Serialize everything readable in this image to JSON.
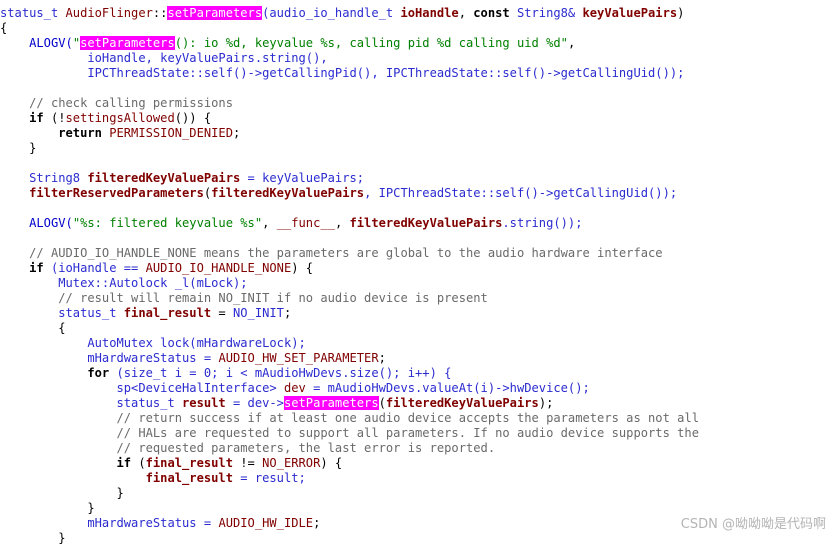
{
  "code_lines": [
    [
      {
        "t": "status_t ",
        "c": "ty"
      },
      {
        "t": "AudioFlinger",
        "c": "cl"
      },
      {
        "t": "::",
        "c": "pr"
      },
      {
        "t": "setParameters",
        "c": "hl"
      },
      {
        "t": "(audio_io_handle_t ",
        "c": "ty"
      },
      {
        "t": "ioHandle",
        "c": "pb"
      },
      {
        "t": ", ",
        "c": "pr"
      },
      {
        "t": "const",
        "c": "kw"
      },
      {
        "t": " String8& ",
        "c": "ty"
      },
      {
        "t": "keyValuePairs",
        "c": "pb"
      },
      {
        "t": ")",
        "c": "pr"
      }
    ],
    [
      {
        "t": "{",
        "c": "pr"
      }
    ],
    [
      {
        "t": "    ALOGV(",
        "c": "mc"
      },
      {
        "t": "\"",
        "c": "str"
      },
      {
        "t": "setParameters",
        "c": "hl"
      },
      {
        "t": "(): io %d, keyvalue %s, calling pid %d calling uid %d\"",
        "c": "str"
      },
      {
        "t": ",",
        "c": "pr"
      }
    ],
    [
      {
        "t": "            ioHandle, keyValuePairs.string(),",
        "c": "ty"
      }
    ],
    [
      {
        "t": "            IPCThreadState::self()->getCallingPid(), IPCThreadState::self()->getCallingUid());",
        "c": "ty"
      }
    ],
    [],
    [
      {
        "t": "    // check calling permissions",
        "c": "cm"
      }
    ],
    [
      {
        "t": "    if",
        "c": "kw"
      },
      {
        "t": " (!",
        "c": "pr"
      },
      {
        "t": "settingsAllowed",
        "c": "fn"
      },
      {
        "t": "()) {",
        "c": "pr"
      }
    ],
    [
      {
        "t": "        return",
        "c": "kw"
      },
      {
        "t": " PERMISSION_DENIED",
        "c": "cl"
      },
      {
        "t": ";",
        "c": "pr"
      }
    ],
    [
      {
        "t": "    }",
        "c": "pr"
      }
    ],
    [],
    [
      {
        "t": "    String8 ",
        "c": "ty"
      },
      {
        "t": "filteredKeyValuePairs",
        "c": "pb"
      },
      {
        "t": " = keyValuePairs;",
        "c": "ty"
      }
    ],
    [
      {
        "t": "    filterReservedParameters",
        "c": "bf"
      },
      {
        "t": "(",
        "c": "pr"
      },
      {
        "t": "filteredKeyValuePairs",
        "c": "pb"
      },
      {
        "t": ", IPCThreadState::self()->getCallingUid());",
        "c": "ty"
      }
    ],
    [],
    [
      {
        "t": "    ALOGV(",
        "c": "mc"
      },
      {
        "t": "\"%s: filtered keyvalue %s\"",
        "c": "str"
      },
      {
        "t": ", ",
        "c": "pr"
      },
      {
        "t": "__func__",
        "c": "cl"
      },
      {
        "t": ", ",
        "c": "pr"
      },
      {
        "t": "filteredKeyValuePairs",
        "c": "pb"
      },
      {
        "t": ".string());",
        "c": "ty"
      }
    ],
    [],
    [
      {
        "t": "    // AUDIO_IO_HANDLE_NONE means the parameters are global to the audio hardware interface",
        "c": "cm"
      }
    ],
    [
      {
        "t": "    if",
        "c": "kw"
      },
      {
        "t": " (ioHandle == ",
        "c": "ty"
      },
      {
        "t": "AUDIO_IO_HANDLE_NONE",
        "c": "cl"
      },
      {
        "t": ") {",
        "c": "pr"
      }
    ],
    [
      {
        "t": "        Mutex::Autolock _l(mLock);",
        "c": "ty"
      }
    ],
    [
      {
        "t": "        // result will remain NO_INIT if no audio device is present",
        "c": "cm"
      }
    ],
    [
      {
        "t": "        status_t ",
        "c": "ty"
      },
      {
        "t": "final_result",
        "c": "pb"
      },
      {
        "t": " = ",
        "c": "pr"
      },
      {
        "t": "NO_INIT",
        "c": "ty"
      },
      {
        "t": ";",
        "c": "pr"
      }
    ],
    [
      {
        "t": "        {",
        "c": "pr"
      }
    ],
    [
      {
        "t": "            AutoMutex lock(mHardwareLock);",
        "c": "ty"
      }
    ],
    [
      {
        "t": "            mHardwareStatus = ",
        "c": "ty"
      },
      {
        "t": "AUDIO_HW_SET_PARAMETER",
        "c": "cl"
      },
      {
        "t": ";",
        "c": "pr"
      }
    ],
    [
      {
        "t": "            for",
        "c": "kw"
      },
      {
        "t": " (size_t i = 0; i < mAudioHwDevs.size(); i++) {",
        "c": "ty"
      }
    ],
    [
      {
        "t": "                sp<DeviceHalInterface> ",
        "c": "ty"
      },
      {
        "t": "dev",
        "c": "cl"
      },
      {
        "t": " = mAudioHwDevs.valueAt(i)->hwDevice();",
        "c": "ty"
      }
    ],
    [
      {
        "t": "                status_t ",
        "c": "ty"
      },
      {
        "t": "result",
        "c": "pb"
      },
      {
        "t": " = dev->",
        "c": "ty"
      },
      {
        "t": "setParameters",
        "c": "hl"
      },
      {
        "t": "(",
        "c": "pr"
      },
      {
        "t": "filteredKeyValuePairs",
        "c": "pb"
      },
      {
        "t": ");",
        "c": "pr"
      }
    ],
    [
      {
        "t": "                // return success if at least one audio device accepts the parameters as not all",
        "c": "cm"
      }
    ],
    [
      {
        "t": "                // HALs are requested to support all parameters. If no audio device supports the",
        "c": "cm"
      }
    ],
    [
      {
        "t": "                // requested parameters, the last error is reported.",
        "c": "cm"
      }
    ],
    [
      {
        "t": "                if",
        "c": "kw"
      },
      {
        "t": " (",
        "c": "pr"
      },
      {
        "t": "final_result",
        "c": "pb"
      },
      {
        "t": " != ",
        "c": "pr"
      },
      {
        "t": "NO_ERROR",
        "c": "cl"
      },
      {
        "t": ") {",
        "c": "pr"
      }
    ],
    [
      {
        "t": "                    final_result",
        "c": "pb"
      },
      {
        "t": " = result;",
        "c": "ty"
      }
    ],
    [
      {
        "t": "                }",
        "c": "pr"
      }
    ],
    [
      {
        "t": "            }",
        "c": "pr"
      }
    ],
    [
      {
        "t": "            mHardwareStatus = ",
        "c": "ty"
      },
      {
        "t": "AUDIO_HW_IDLE",
        "c": "cl"
      },
      {
        "t": ";",
        "c": "pr"
      }
    ],
    [
      {
        "t": "        }",
        "c": "pr"
      }
    ]
  ],
  "watermark": "CSDN @呦呦呦是代码啊"
}
